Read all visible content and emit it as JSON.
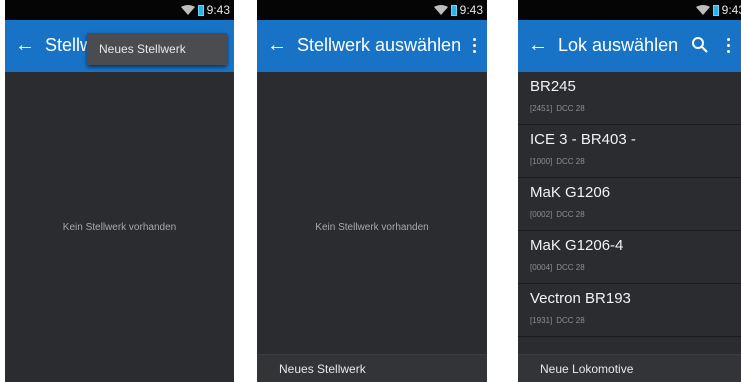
{
  "screens": [
    {
      "status": {
        "time": "9:43"
      },
      "appbar": {
        "title": "Stellw"
      },
      "popup_menu": {
        "items": [
          {
            "label": "Neues Stellwerk"
          }
        ]
      },
      "empty_text": "Kein Stellwerk vorhanden"
    },
    {
      "status": {
        "time": "9:43"
      },
      "appbar": {
        "title": "Stellwerk auswählen"
      },
      "empty_text": "Kein Stellwerk vorhanden",
      "bottom_button": "Neues Stellwerk"
    },
    {
      "status": {
        "time": "9:43"
      },
      "appbar": {
        "title": "Lok auswählen"
      },
      "locos": [
        {
          "name": "BR245",
          "address": "[2451]",
          "protocol": "DCC 28"
        },
        {
          "name": "ICE 3 - BR403 -",
          "address": "[1000]",
          "protocol": "DCC 28"
        },
        {
          "name": "MaK G1206",
          "address": "[0002]",
          "protocol": "DCC 28"
        },
        {
          "name": "MaK G1206-4",
          "address": "[0004]",
          "protocol": "DCC 28"
        },
        {
          "name": "Vectron BR193",
          "address": "[1931]",
          "protocol": "DCC 28"
        }
      ],
      "bottom_button": "Neue Lokomotive"
    }
  ],
  "colors": {
    "appbar": "#1873c7",
    "background": "#2a2c2f",
    "battery": "#2ab4e6"
  },
  "icons": [
    "back-arrow-icon",
    "overflow-menu-icon",
    "search-icon",
    "wifi-icon",
    "battery-icon"
  ]
}
